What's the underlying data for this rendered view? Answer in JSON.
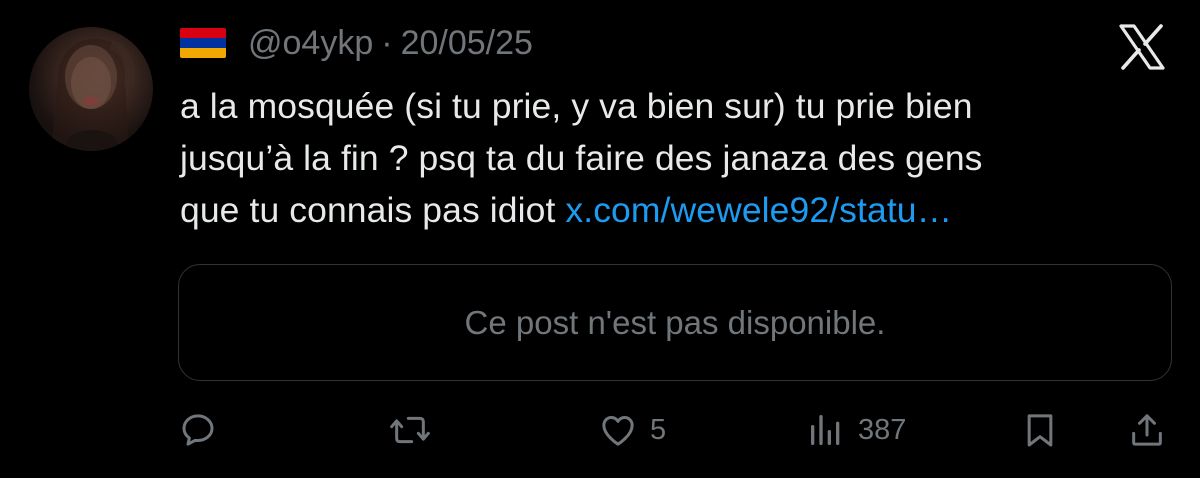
{
  "tweet": {
    "handle": "@o4ykp",
    "separator": "·",
    "date": "20/05/25",
    "flag_colors": [
      "#d90012",
      "#0033a0",
      "#f2a800"
    ],
    "text_lines": [
      "a la mosquée (si tu prie, y va bien sur) tu prie bien",
      "jusqu’à la fin ? psq ta du faire des janaza des gens",
      "que tu connais pas idiot "
    ],
    "link_text": "x.com/wewele92/statu…",
    "link_color": "#1d9bf0",
    "quote_unavailable": "Ce post n'est pas disponible."
  },
  "actions": {
    "reply_icon": "reply-icon",
    "retweet_icon": "retweet-icon",
    "like_icon": "heart-icon",
    "like_count": "5",
    "views_icon": "views-icon",
    "views_count": "387",
    "bookmark_icon": "bookmark-icon",
    "share_icon": "share-icon"
  },
  "colors": {
    "background": "#000000",
    "text": "#e7e9ea",
    "muted": "#71767b",
    "border": "#2f3336"
  }
}
